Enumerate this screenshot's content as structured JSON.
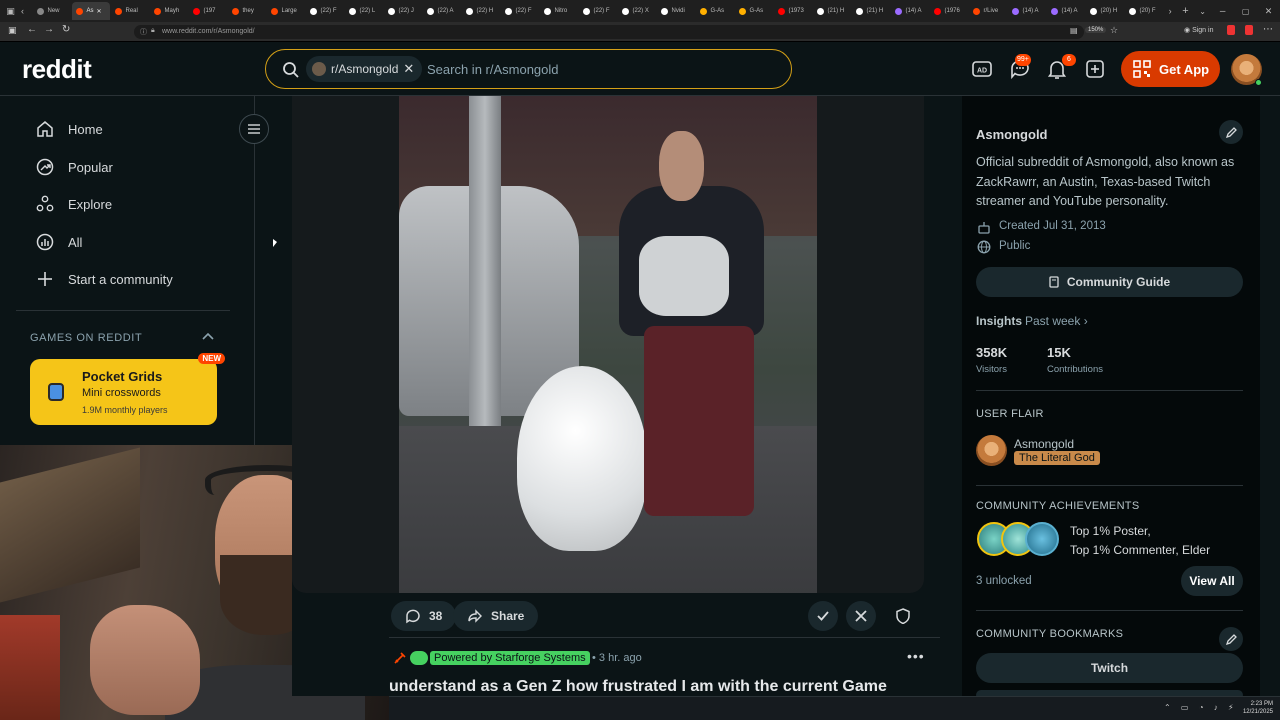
{
  "browser": {
    "tabs": [
      {
        "label": "New",
        "color": "#888888"
      },
      {
        "label": "As",
        "color": "#ff4500",
        "active": true
      },
      {
        "label": "Real",
        "color": "#ff4500"
      },
      {
        "label": "Mayh",
        "color": "#ff4500"
      },
      {
        "label": "(197",
        "color": "#ff0000"
      },
      {
        "label": "they",
        "color": "#ff4500"
      },
      {
        "label": "Large",
        "color": "#ff4500"
      },
      {
        "label": "(22) F",
        "color": "#ffffff"
      },
      {
        "label": "(22) L",
        "color": "#ffffff"
      },
      {
        "label": "(22) J",
        "color": "#ffffff"
      },
      {
        "label": "(22) A",
        "color": "#ffffff"
      },
      {
        "label": "(22) H",
        "color": "#ffffff"
      },
      {
        "label": "(22) F",
        "color": "#ffffff"
      },
      {
        "label": "Nitro",
        "color": "#ffffff"
      },
      {
        "label": "(22) F",
        "color": "#ffffff"
      },
      {
        "label": "(22) X",
        "color": "#ffffff"
      },
      {
        "label": "Nvidi",
        "color": "#ffffff"
      },
      {
        "label": "G-As",
        "color": "#ffb000"
      },
      {
        "label": "G-As",
        "color": "#ffb000"
      },
      {
        "label": "(1973",
        "color": "#ff0000"
      },
      {
        "label": "(21) H",
        "color": "#ffffff"
      },
      {
        "label": "(21) H",
        "color": "#ffffff"
      },
      {
        "label": "(14) A",
        "color": "#9b6bff"
      },
      {
        "label": "(1976",
        "color": "#ff0000"
      },
      {
        "label": "r/Live",
        "color": "#ff4500"
      },
      {
        "label": "(14) A",
        "color": "#9b6bff"
      },
      {
        "label": "(14) A",
        "color": "#9b6bff"
      },
      {
        "label": "(20) H",
        "color": "#ffffff"
      },
      {
        "label": "(20) F",
        "color": "#ffffff"
      }
    ],
    "url": "www.reddit.com/r/Asmongold/",
    "zoom": "150%",
    "sign_in": "Sign in"
  },
  "header": {
    "logo": "reddit",
    "search_chip": "r/Asmongold",
    "search_placeholder": "Search in r/Asmongold",
    "chat_badge": "99+",
    "notif_badge": "6",
    "get_app": "Get App"
  },
  "nav": {
    "items": [
      {
        "label": "Home",
        "icon": "home-icon"
      },
      {
        "label": "Popular",
        "icon": "popular-icon"
      },
      {
        "label": "Explore",
        "icon": "explore-icon"
      },
      {
        "label": "All",
        "icon": "all-icon"
      },
      {
        "label": "Start a community",
        "icon": "plus-icon"
      }
    ],
    "games_heading": "GAMES ON REDDIT",
    "game": {
      "title": "Pocket Grids",
      "subtitle": "Mini crosswords",
      "players": "1.9M monthly players",
      "badge": "NEW"
    }
  },
  "post": {
    "comments": "38",
    "share": "Share",
    "flair": "Powered by Starforge Systems",
    "time": "3 hr. ago",
    "title": "understand as a Gen Z how frustrated I am with the current Game"
  },
  "sidebar": {
    "name": "Asmongold",
    "description": "Official subreddit of Asmongold, also known as ZackRawrr, an Austin, Texas-based Twitch streamer and YouTube personality.",
    "created": "Created Jul 31, 2013",
    "visibility": "Public",
    "guide_button": "Community Guide",
    "insights": "Insights",
    "insights_range": "Past week",
    "visitors_value": "358K",
    "visitors_label": "Visitors",
    "contributions_value": "15K",
    "contributions_label": "Contributions",
    "user_flair_heading": "USER FLAIR",
    "user_name": "Asmongold",
    "user_flair": "The Literal God",
    "achievements_heading": "COMMUNITY ACHIEVEMENTS",
    "achievement_line1": "Top 1% Poster,",
    "achievement_line2": "Top 1% Commenter, Elder",
    "unlocked": "3 unlocked",
    "view_all": "View All",
    "bookmarks_heading": "COMMUNITY BOOKMARKS",
    "bookmark_1": "Twitch"
  },
  "taskbar": {
    "time": "2:23 PM",
    "date": "12/21/2025"
  }
}
